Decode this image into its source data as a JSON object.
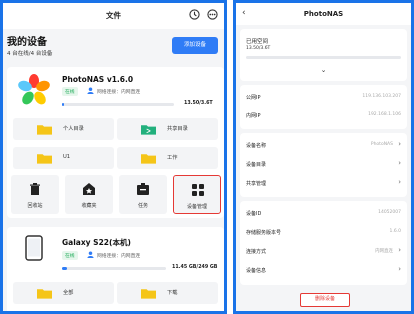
{
  "left": {
    "header": {
      "title": "文件",
      "history_icon": "history-icon",
      "more_icon": "more-icon"
    },
    "my_devices": {
      "title": "我的设备",
      "subtitle": "4 台在线/4 台设备"
    },
    "add_device_label": "添加设备",
    "nas_card": {
      "name": "PhotoNAS  v1.6.0",
      "status": "在线",
      "network": "网络连接：内网直连",
      "storage": "13.50/3.6T",
      "usage_fraction": 0.004,
      "folders": [
        {
          "label": "个人目录",
          "icon": "folder-icon",
          "color": "#f5c518"
        },
        {
          "label": "共享目录",
          "icon": "shared-folder-icon",
          "color": "#22b07d"
        },
        {
          "label": "U1",
          "icon": "folder-icon",
          "color": "#f5c518"
        },
        {
          "label": "工作",
          "icon": "folder-icon",
          "color": "#f5c518"
        }
      ],
      "actions": [
        {
          "label": "回收站",
          "icon": "trash-icon"
        },
        {
          "label": "收藏夹",
          "icon": "favorites-icon"
        },
        {
          "label": "任务",
          "icon": "task-icon"
        },
        {
          "label": "设备管理",
          "icon": "device-manage-icon"
        }
      ]
    },
    "phone_card": {
      "name": "Galaxy S22(本机)",
      "status": "在线",
      "network": "网络连接：内网直连",
      "storage": "11.45 GB/249 GB",
      "usage_fraction": 0.05,
      "folders": [
        {
          "label": "全部",
          "icon": "folder-icon"
        },
        {
          "label": "下载",
          "icon": "folder-icon"
        }
      ]
    }
  },
  "right": {
    "header": {
      "title": "PhotoNAS"
    },
    "space": {
      "title": "已用空间",
      "value": "13.50/3.6T"
    },
    "network": [
      {
        "key": "公网IP",
        "value": "119.136.103.207"
      },
      {
        "key": "内网IP",
        "value": "192.168.1.106"
      }
    ],
    "settings": [
      {
        "key": "设备名称",
        "value": "PhotoNAS",
        "chevron": true
      },
      {
        "key": "设备目录",
        "value": "",
        "chevron": true
      },
      {
        "key": "共享管理",
        "value": "",
        "chevron": true
      }
    ],
    "info": [
      {
        "key": "设备ID",
        "value": "14052007",
        "chevron": false
      },
      {
        "key": "存储服务版本号",
        "value": "1.6.0",
        "chevron": false
      },
      {
        "key": "连接方式",
        "value": "内网直连",
        "chevron": true
      },
      {
        "key": "设备信息",
        "value": "",
        "chevron": true
      }
    ],
    "delete_label": "删除设备"
  },
  "colors": {
    "accent": "#2f7cf6",
    "highlight": "#e53935",
    "online": "#1aaa55"
  }
}
